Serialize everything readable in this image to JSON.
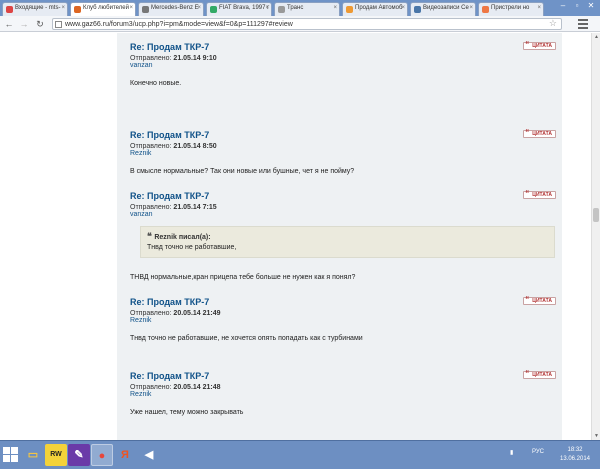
{
  "browser": {
    "tabs": [
      {
        "title": "Входящие - mts-",
        "color": "#d44"
      },
      {
        "title": "Клуб любителей",
        "color": "#d62"
      },
      {
        "title": "Mercedes-Benz E",
        "color": "#777"
      },
      {
        "title": "FIAT Brava, 1997 г",
        "color": "#3a6"
      },
      {
        "title": "Транс",
        "color": "#999"
      },
      {
        "title": "Продам Автомоб",
        "color": "#e93"
      },
      {
        "title": "Видеозаписи Се",
        "color": "#4a76a8"
      },
      {
        "title": "Пристрели но",
        "color": "#e74"
      }
    ],
    "active_tab": 1,
    "url": "www.gaz66.ru/forum3/ucp.php?i=pm&mode=view&f=0&p=111297#review"
  },
  "posts": [
    {
      "title": "Re: Продам ТКР-7",
      "posted_label": "Отправлено:",
      "date": "21.05.14 9:10",
      "author": "vanzan",
      "text": "Конечно новые.",
      "quote_label": "ЦИТАТА"
    },
    {
      "title": "Re: Продам ТКР-7",
      "posted_label": "Отправлено:",
      "date": "21.05.14 8:50",
      "author": "Reznik",
      "text": "В смысле нормальные? Так они новые или бушные, чет я не пойму?",
      "quote_label": "ЦИТАТА"
    },
    {
      "title": "Re: Продам ТКР-7",
      "posted_label": "Отправлено:",
      "date": "21.05.14 7:15",
      "author": "vanzan",
      "quote": {
        "cite": "Reznik писал(а):",
        "text": "Тнвд точно не работавшие,"
      },
      "text": "ТНВД нормальные,кран прицепа тебе больше не нужен как я понял?",
      "quote_label": "ЦИТАТА"
    },
    {
      "title": "Re: Продам ТКР-7",
      "posted_label": "Отправлено:",
      "date": "20.05.14 21:49",
      "author": "Reznik",
      "text": "Тнвд точно не работавшие, не хочется опять попадать как с турбинами",
      "quote_label": "ЦИТАТА"
    },
    {
      "title": "Re: Продам ТКР-7",
      "posted_label": "Отправлено:",
      "date": "20.05.14 21:48",
      "author": "Reznik",
      "text": "Уже нашел, тему можно закрывать",
      "quote_label": "ЦИТАТА"
    }
  ],
  "taskbar": {
    "apps": [
      {
        "name": "explorer",
        "glyph": "▭",
        "color": "#f5c542"
      },
      {
        "name": "rw",
        "glyph": "RW",
        "color": "#222"
      },
      {
        "name": "app-purple",
        "glyph": "✎",
        "color": "#fff"
      },
      {
        "name": "chrome",
        "glyph": "●",
        "color": "#fff"
      },
      {
        "name": "yandex",
        "glyph": "Я",
        "color": "#e52"
      },
      {
        "name": "audio",
        "glyph": "◀",
        "color": "#fff"
      }
    ],
    "language": "РУС",
    "time": "18:32",
    "date": "13.06.2014"
  }
}
